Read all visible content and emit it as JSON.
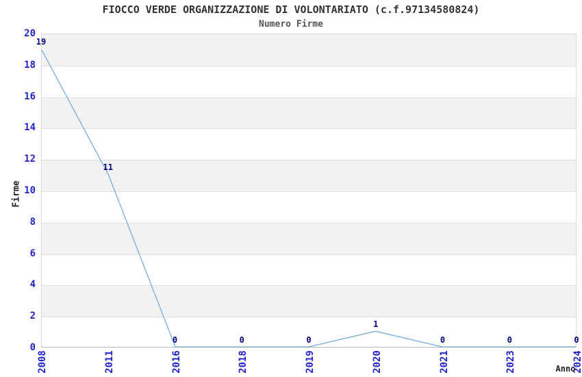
{
  "header": {
    "title": "FIOCCO VERDE ORGANIZZAZIONE DI VOLONTARIATO (c.f.97134580824)",
    "subtitle": "Numero Firme"
  },
  "colors": {
    "line": "#76ace2",
    "tick_label": "#2323cc",
    "data_label": "#000080",
    "band": "#f2f2f2",
    "grid": "#e0e0e0",
    "plot_border": "#d9d9d9",
    "axis_line": "#b3b3b3",
    "title": "#333333",
    "subtitle": "#555555",
    "axis_title": "#222222"
  },
  "chart_data": {
    "type": "line",
    "title": "FIOCCO VERDE ORGANIZZAZIONE DI VOLONTARIATO (c.f.97134580824)",
    "subtitle": "Numero Firme",
    "categories": [
      "2008",
      "2011",
      "2016",
      "2018",
      "2019",
      "2020",
      "2021",
      "2023",
      "2024"
    ],
    "values": [
      19,
      11,
      0,
      0,
      0,
      1,
      0,
      0,
      0
    ],
    "xlabel": "Anno",
    "ylabel": "Firme",
    "ylim": [
      0,
      20
    ],
    "yticks": [
      0,
      2,
      4,
      6,
      8,
      10,
      12,
      14,
      16,
      18,
      20
    ],
    "grid": true,
    "banded_rows": true,
    "legend_position": "none",
    "data_labels_shown": true
  }
}
